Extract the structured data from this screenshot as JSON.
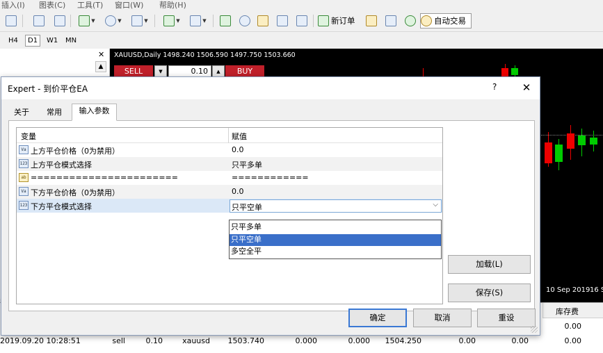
{
  "menu": [
    "插入(I)",
    "图表(C)",
    "工具(T)",
    "窗口(W)",
    "帮助(H)"
  ],
  "toolbar": {
    "new_order": "新订单",
    "auto_trading": "自动交易"
  },
  "timeframes": [
    "H4",
    "D1",
    "W1",
    "MN"
  ],
  "timeframe_active": "D1",
  "chart": {
    "title": "XAUUSD,Daily  1498.240 1506.590 1497.750 1503.660",
    "sell_label": "SELL",
    "buy_label": "BUY",
    "lot": "0.10",
    "dates": [
      "10 Sep 2019",
      "16 S"
    ]
  },
  "dialog": {
    "title": "Expert - 到价平仓EA",
    "help": "?",
    "close": "✕",
    "tabs": [
      "关于",
      "常用",
      "输入参数"
    ],
    "active_tab": "输入参数",
    "grid": {
      "col_variable": "变量",
      "col_value": "赋值",
      "rows": [
        {
          "icon": "Va",
          "name": "上方平仓价格（0为禁用）",
          "value": "0.0"
        },
        {
          "icon": "123",
          "name": "上方平仓模式选择",
          "value": "只平多单"
        },
        {
          "icon": "ab",
          "name": "=======================",
          "value": "============"
        },
        {
          "icon": "Va",
          "name": "下方平仓价格（0为禁用）",
          "value": "0.0"
        },
        {
          "icon": "123",
          "name": "下方平仓模式选择",
          "value": "只平空单"
        }
      ]
    },
    "dropdown_options": [
      "只平多单",
      "只平空单",
      "多空全平"
    ],
    "dropdown_selected": "只平空单",
    "load_button": "加载(L)",
    "save_button": "保存(S)",
    "ok_button": "确定",
    "cancel_button": "取消",
    "reset_button": "重设"
  },
  "terminal": {
    "swap_header": "库存费",
    "rows": [
      {
        "swap": "0.00"
      },
      {
        "time": "2019.09.20 10:28:51",
        "type": "sell",
        "volume": "0.10",
        "symbol": "xauusd",
        "price": "1503.740",
        "sl": "0.000",
        "tp": "0.000",
        "current": "1504.250",
        "commission": "0.00",
        "swap": "0.00",
        "profit": "0.00"
      }
    ]
  }
}
